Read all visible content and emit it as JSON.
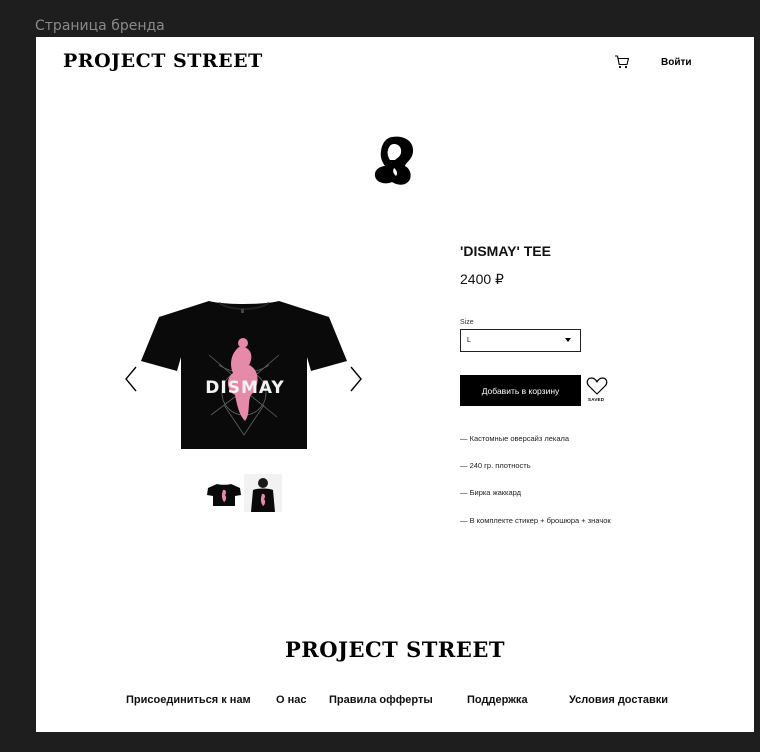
{
  "frame": {
    "label": "Страница бренда"
  },
  "header": {
    "logo": "PROJECT STREET",
    "cart_icon": "cart-icon",
    "login_label": "Войти"
  },
  "brand_icon": "brand-mark-icon",
  "gallery": {
    "main_image": "t-shirt-dismay-front",
    "graphic_text": "DISMAY",
    "thumbnails": [
      "t-shirt-thumbnail",
      "model-wearing-shirt-thumbnail"
    ],
    "prev_icon": "chevron-left-icon",
    "next_icon": "chevron-right-icon"
  },
  "product": {
    "title": "'DISMAY' TEE",
    "price": "2400 ₽",
    "size_label": "Size",
    "size_value": "L",
    "add_to_cart": "Добавить в корзину",
    "saved_label": "SAVED",
    "features": [
      "— Кастомные оверсайз лекала",
      "— 240 гр. плотность",
      "— Бирка жаккард",
      "— В комплекте стикер + брошюра + значок"
    ]
  },
  "footer": {
    "logo": "PROJECT STREET",
    "links": [
      "Присоединиться к нам",
      "О нас",
      "Правила офферты",
      "Поддержка",
      "Условия доставки"
    ]
  },
  "colors": {
    "frame_bg": "#1e1e1e",
    "page_bg": "#ffffff",
    "button_bg": "#000000",
    "accent_pink": "#e58aa8"
  }
}
